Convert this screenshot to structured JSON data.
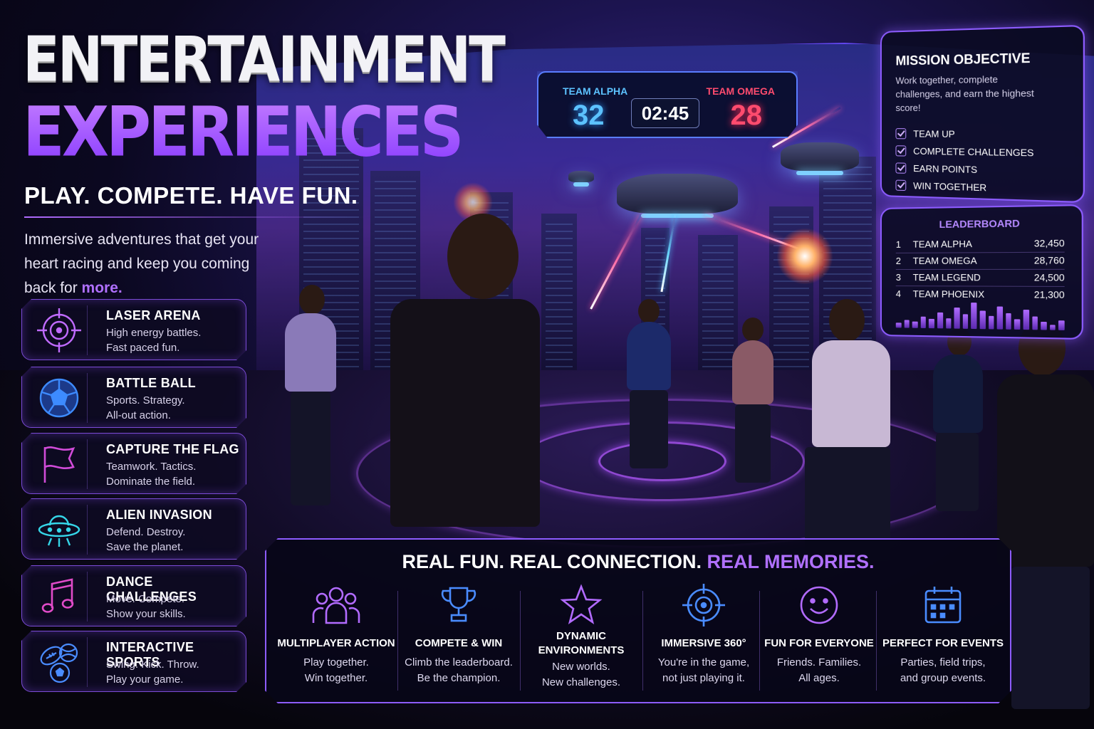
{
  "hero": {
    "title_line1": "ENTERTAINMENT",
    "title_line2": "EXPERIENCES",
    "tagline": "PLAY. COMPETE. HAVE FUN.",
    "intro": "Immersive adventures that get your heart racing and keep you coming back for",
    "intro_highlight": "more."
  },
  "experiences": [
    {
      "icon": "crosshair-icon",
      "title": "LASER ARENA",
      "desc1": "High energy battles.",
      "desc2": "Fast paced fun."
    },
    {
      "icon": "soccer-ball-icon",
      "title": "BATTLE BALL",
      "desc1": "Sports. Strategy.",
      "desc2": "All-out action."
    },
    {
      "icon": "flag-icon",
      "title": "CAPTURE THE FLAG",
      "desc1": "Teamwork. Tactics.",
      "desc2": "Dominate the field."
    },
    {
      "icon": "ufo-icon",
      "title": "ALIEN INVASION",
      "desc1": "Defend. Destroy.",
      "desc2": "Save the planet."
    },
    {
      "icon": "music-note-icon",
      "title": "DANCE CHALLENGES",
      "desc1": "Move. Compete.",
      "desc2": "Show your skills."
    },
    {
      "icon": "sports-balls-icon",
      "title": "INTERACTIVE SPORTS",
      "desc1": "Swing. Kick. Throw.",
      "desc2": "Play your game."
    }
  ],
  "scoreboard": {
    "team_a": "TEAM ALPHA",
    "score_a": "32",
    "timer": "02:45",
    "team_b": "TEAM OMEGA",
    "score_b": "28"
  },
  "mission": {
    "title": "MISSION OBJECTIVE",
    "text": "Work together, complete challenges, and earn the highest score!",
    "items": [
      "TEAM UP",
      "COMPLETE CHALLENGES",
      "EARN POINTS",
      "WIN TOGETHER"
    ]
  },
  "leaderboard": {
    "title": "LEADERBOARD",
    "rows": [
      {
        "rank": "1",
        "team": "TEAM ALPHA",
        "points": "32,450"
      },
      {
        "rank": "2",
        "team": "TEAM OMEGA",
        "points": "28,760"
      },
      {
        "rank": "3",
        "team": "TEAM LEGEND",
        "points": "24,500"
      },
      {
        "rank": "4",
        "team": "TEAM PHOENIX",
        "points": "21,300"
      }
    ]
  },
  "bottom": {
    "headline": "REAL FUN. REAL CONNECTION.",
    "headline_highlight": "REAL MEMORIES.",
    "features": [
      {
        "icon": "group-icon",
        "title": "MULTIPLAYER ACTION",
        "desc1": "Play together.",
        "desc2": "Win together."
      },
      {
        "icon": "trophy-icon",
        "title": "COMPETE & WIN",
        "desc1": "Climb the leaderboard.",
        "desc2": "Be the champion."
      },
      {
        "icon": "star-icon",
        "title": "DYNAMIC ENVIRONMENTS",
        "desc1": "New worlds.",
        "desc2": "New challenges."
      },
      {
        "icon": "target-icon",
        "title": "IMMERSIVE 360°",
        "desc1": "You're in the game,",
        "desc2": "not just playing it."
      },
      {
        "icon": "smiley-icon",
        "title": "FUN FOR EVERYONE",
        "desc1": "Friends. Families.",
        "desc2": "All ages."
      },
      {
        "icon": "calendar-icon",
        "title": "PERFECT FOR EVENTS",
        "desc1": "Parties, field trips,",
        "desc2": "and group events."
      }
    ]
  },
  "colors": {
    "accent": "#a259ff",
    "team_a": "#5cc2ff",
    "team_b": "#ff4b6e",
    "panel_border": "#8d5cff"
  }
}
